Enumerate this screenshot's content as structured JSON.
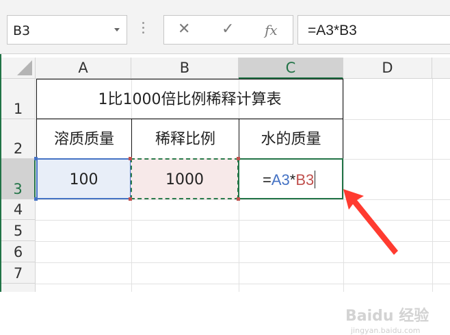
{
  "name_box": {
    "value": "B3"
  },
  "formula_bar": {
    "cancel_icon": "close-icon",
    "enter_icon": "check-icon",
    "fx_label": "fx",
    "formula": "=A3*B3"
  },
  "columns": [
    "A",
    "B",
    "C",
    "D"
  ],
  "rows": [
    "1",
    "2",
    "3",
    "4",
    "5",
    "6",
    "7"
  ],
  "cells": {
    "title": "1比1000倍比例稀释计算表",
    "a2": "溶质质量",
    "b2": "稀释比例",
    "c2": "水的质量",
    "a3": "100",
    "b3": "1000",
    "c3": {
      "prefix": "=",
      "ref1": "A3",
      "op": "*",
      "ref2": "B3"
    }
  },
  "watermark": {
    "line1": "Baidu 经验",
    "line2": "jingyan.baidu.com"
  },
  "colors": {
    "accent": "#217346",
    "ref_blue": "#4472c4",
    "ref_red": "#c0504d",
    "arrow": "#ff3b30"
  }
}
